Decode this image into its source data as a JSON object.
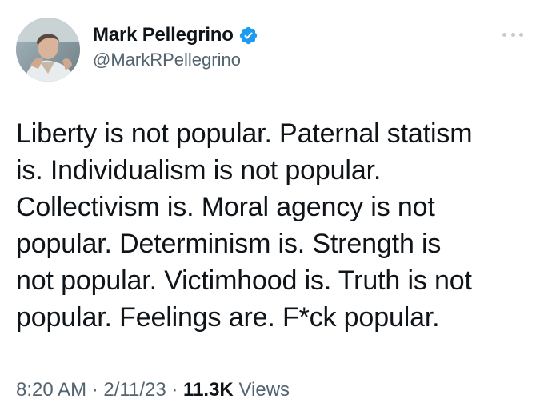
{
  "author": {
    "display_name": "Mark Pellegrino",
    "handle": "@MarkRPellegrino",
    "verified": true,
    "verified_color": "#1d9bf0"
  },
  "menu": {
    "icon": "more-horizontal-icon"
  },
  "tweet": {
    "lines": [
      "Liberty is not popular. Paternal statism",
      "is. Individualism is not popular.",
      "Collectivism is. Moral agency is not",
      "popular. Determinism is. Strength is",
      "not popular. Victimhood is. Truth is not",
      "popular. Feelings are. F*ck popular."
    ]
  },
  "meta": {
    "time": "8:20 AM",
    "separator": "·",
    "date": "2/11/23",
    "views_count": "11.3K",
    "views_label": "Views"
  }
}
